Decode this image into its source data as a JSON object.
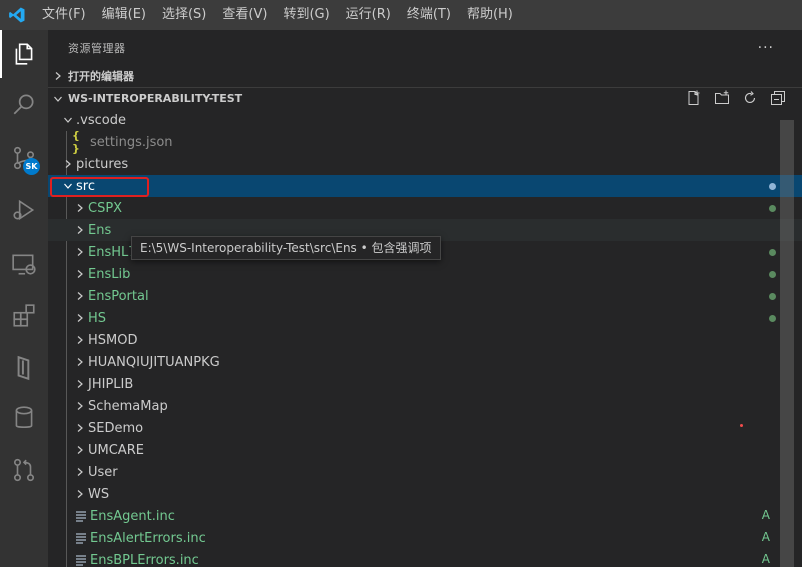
{
  "menubar": {
    "items": [
      "文件(F)",
      "编辑(E)",
      "选择(S)",
      "查看(V)",
      "转到(G)",
      "运行(R)",
      "终端(T)",
      "帮助(H)"
    ]
  },
  "activitybar": {
    "icons": [
      "files-icon",
      "search-icon",
      "source-control-icon",
      "run-debug-icon",
      "remote-explorer-icon",
      "extensions-icon",
      "intersystems-icon",
      "database-icon",
      "pull-request-icon"
    ],
    "badge": "SK"
  },
  "sidebar": {
    "title": "资源管理器",
    "more": "···",
    "open_editors": "打开的编辑器",
    "project": "WS-INTEROPERABILITY-TEST"
  },
  "tree": {
    "vscode": ".vscode",
    "settings": "settings.json",
    "pictures": "pictures",
    "src": "src",
    "folders": [
      {
        "label": "CSPX",
        "status": "modified"
      },
      {
        "label": "Ens",
        "status": "modified"
      },
      {
        "label": "EnsHL7",
        "status": "modified"
      },
      {
        "label": "EnsLib",
        "status": "modified"
      },
      {
        "label": "EnsPortal",
        "status": "modified"
      },
      {
        "label": "HS",
        "status": "modified"
      },
      {
        "label": "HSMOD",
        "status": ""
      },
      {
        "label": "HUANQIUJITUANPKG",
        "status": ""
      },
      {
        "label": "JHIPLIB",
        "status": ""
      },
      {
        "label": "SchemaMap",
        "status": ""
      },
      {
        "label": "SEDemo",
        "status": ""
      },
      {
        "label": "UMCARE",
        "status": ""
      },
      {
        "label": "User",
        "status": ""
      },
      {
        "label": "WS",
        "status": ""
      }
    ],
    "files": [
      {
        "label": "EnsAgent.inc",
        "status": "A"
      },
      {
        "label": "EnsAlertErrors.inc",
        "status": "A"
      },
      {
        "label": "EnsBPLErrors.inc",
        "status": "A"
      }
    ]
  },
  "tooltip": "E:\\5\\WS-Interoperability-Test\\src\\Ens • 包含强调项",
  "colors": {
    "accent": "#007acc",
    "selection": "#094771",
    "git_modified": "#73c991",
    "highlight_box": "#e02020"
  }
}
